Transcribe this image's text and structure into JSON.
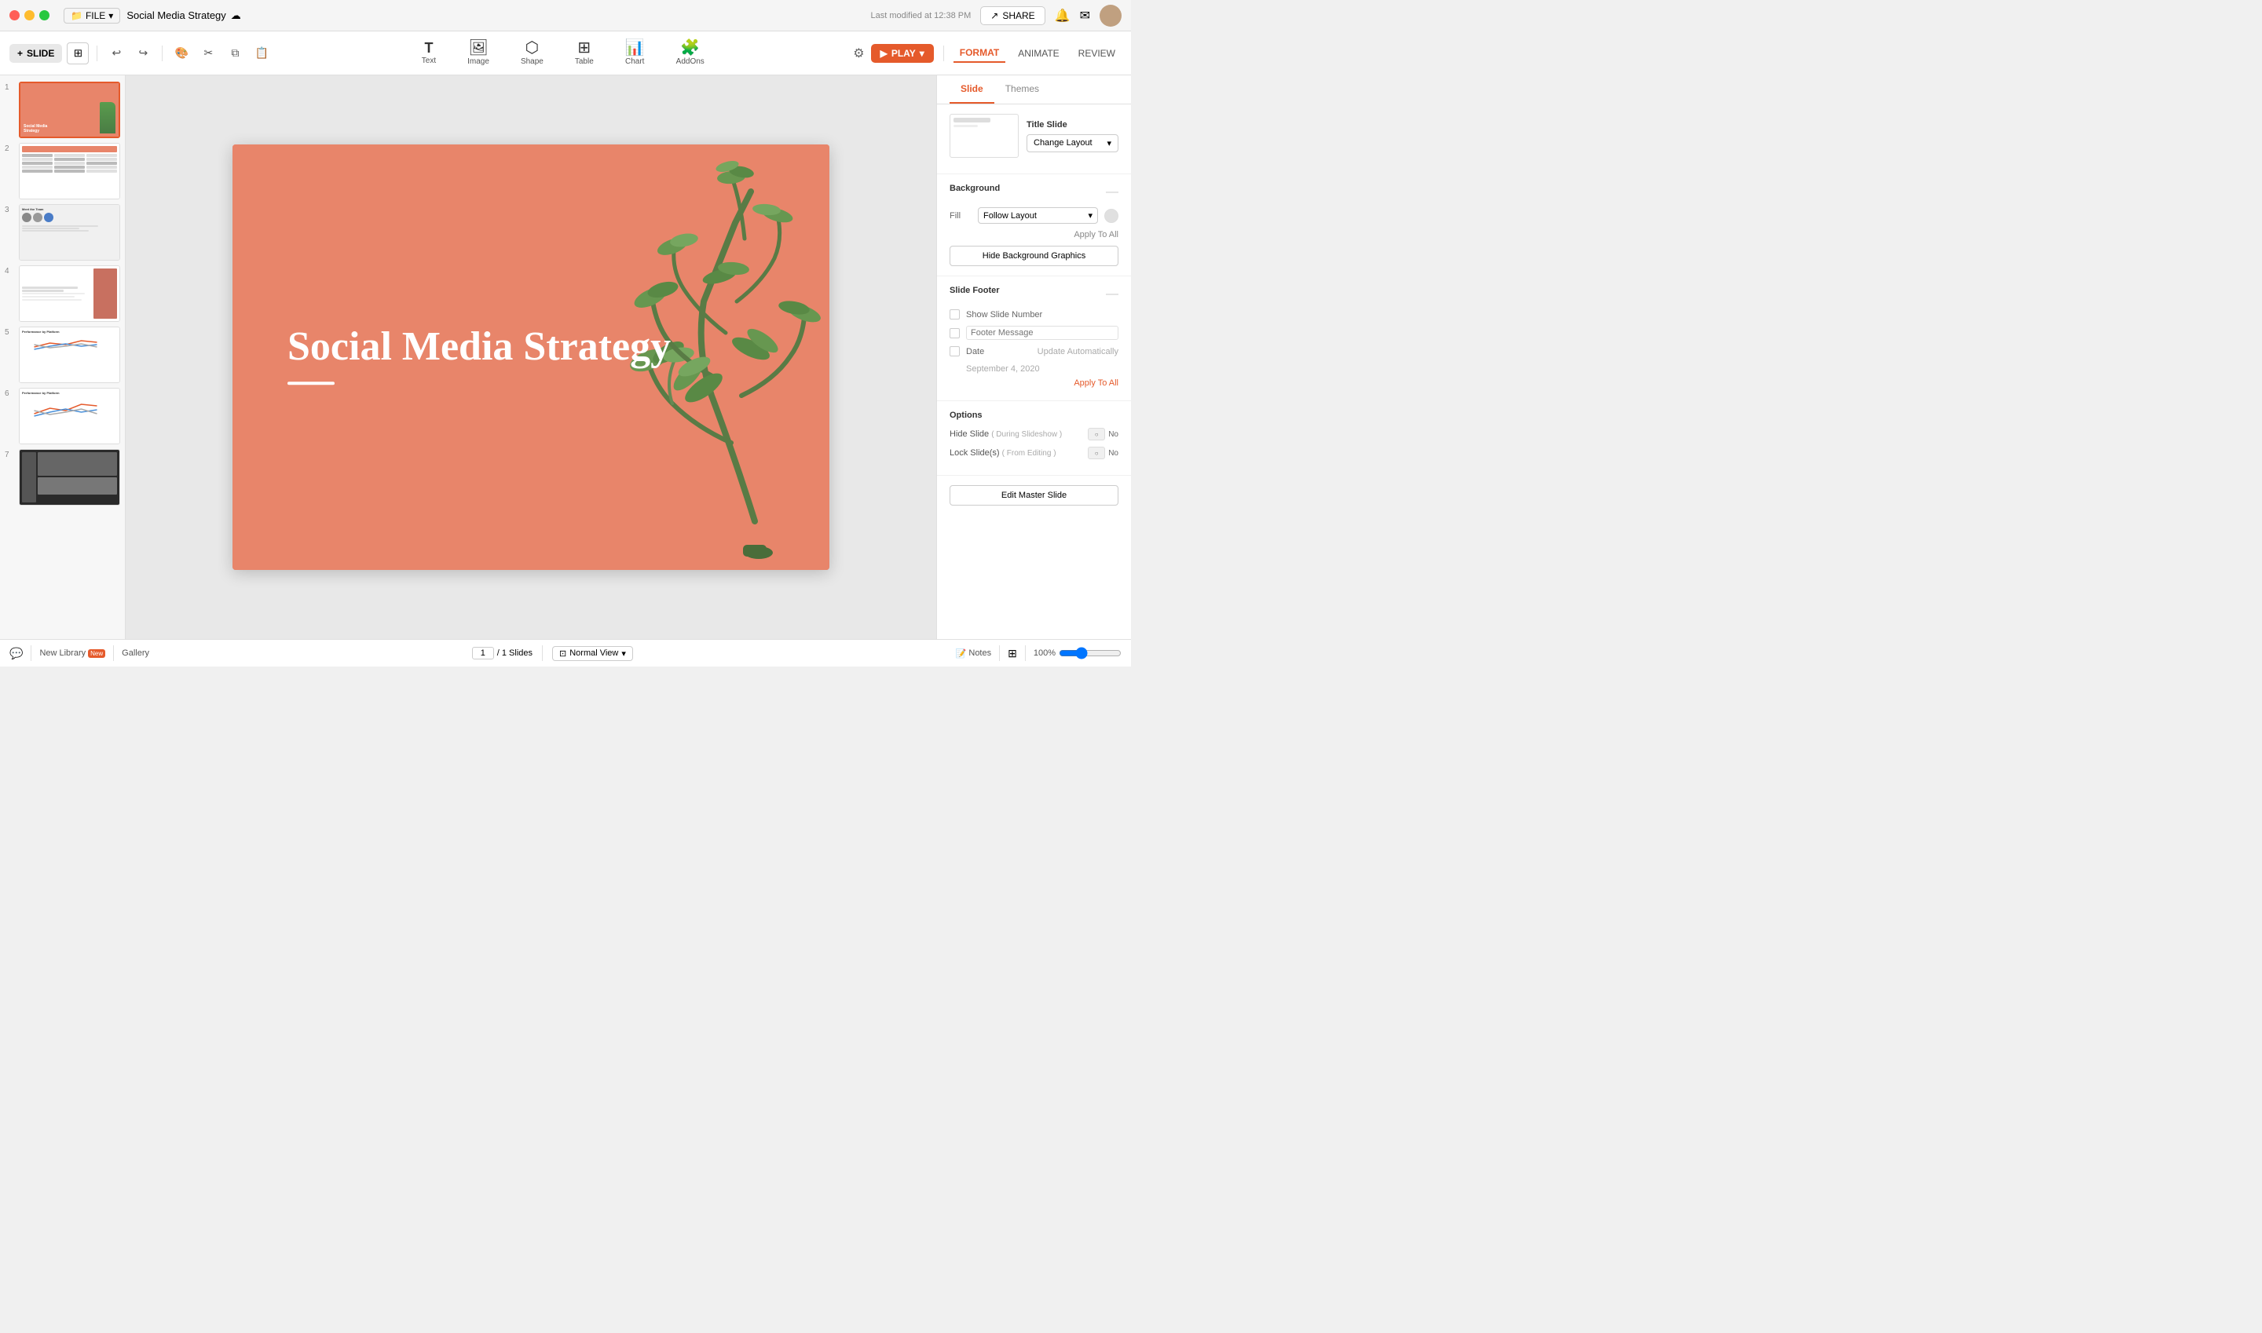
{
  "titlebar": {
    "file_label": "FILE",
    "doc_title": "Social Media Strategy",
    "modified_text": "Last modified at 12:38 PM",
    "share_label": "SHARE"
  },
  "toolbar": {
    "slide_label": "SLIDE",
    "tools": [
      {
        "id": "text",
        "label": "Text",
        "icon": "T"
      },
      {
        "id": "image",
        "label": "Image",
        "icon": "🖼"
      },
      {
        "id": "shape",
        "label": "Shape",
        "icon": "⬡"
      },
      {
        "id": "table",
        "label": "Table",
        "icon": "⊞"
      },
      {
        "id": "chart",
        "label": "Chart",
        "icon": "📊"
      },
      {
        "id": "addons",
        "label": "AddOns",
        "icon": "🧩"
      }
    ],
    "play_label": "PLAY",
    "format_label": "FORMAT",
    "animate_label": "ANIMATE",
    "review_label": "REVIEW"
  },
  "slide": {
    "title": "Social Media Strategy",
    "bg_color": "#e8856a"
  },
  "panel": {
    "slide_tab": "Slide",
    "themes_tab": "Themes",
    "layout_title": "Title Slide",
    "change_layout_label": "Change Layout",
    "background_title": "Background",
    "fill_label": "Fill",
    "fill_value": "Follow Layout",
    "apply_to_all": "Apply To All",
    "hide_bg_btn": "Hide Background Graphics",
    "footer_title": "Slide Footer",
    "show_slide_number_label": "Show Slide Number",
    "footer_message_label": "Footer Message",
    "date_label": "Date",
    "update_automatically_label": "Update Automatically",
    "date_value": "September 4, 2020",
    "footer_apply_all": "Apply To All",
    "options_title": "Options",
    "hide_slide_label": "Hide Slide",
    "hide_slide_sub": "( During Slideshow )",
    "lock_slide_label": "Lock Slide(s)",
    "lock_slide_sub": "( From Editing )",
    "no_label": "No",
    "edit_master_btn": "Edit Master Slide"
  },
  "bottombar": {
    "new_library_label": "New Library",
    "new_badge": "New",
    "gallery_label": "Gallery",
    "page_current": "1",
    "page_total": "/ 1 Slides",
    "normal_view_label": "Normal View",
    "notes_label": "Notes",
    "zoom_percent": "100%"
  }
}
